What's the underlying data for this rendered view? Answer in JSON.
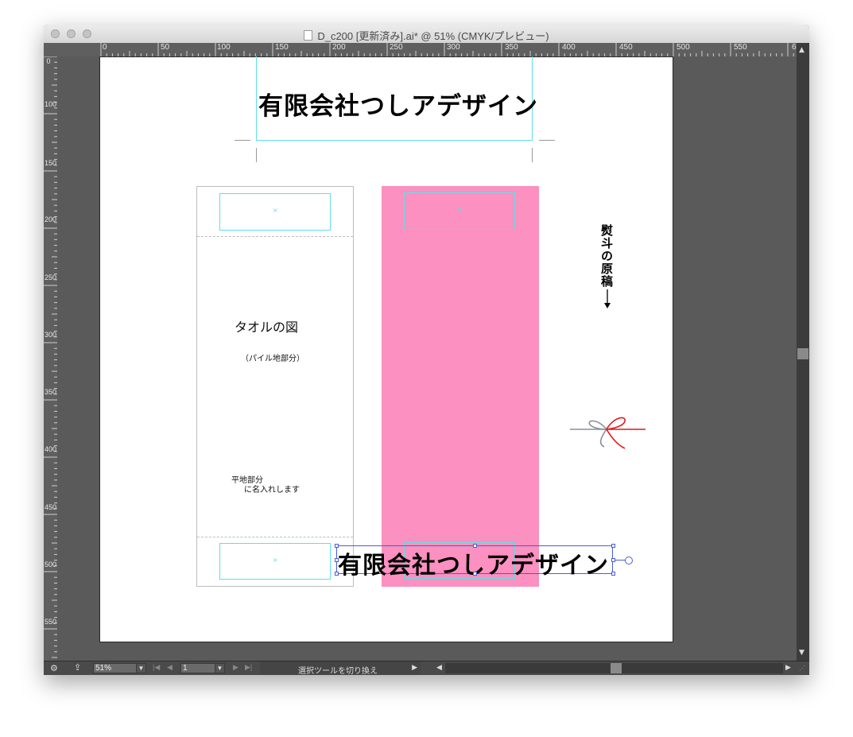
{
  "window": {
    "title": "D_c200 [更新済み].ai* @ 51% (CMYK/プレビュー)"
  },
  "ruler": {
    "top_labels": [
      "0",
      "50",
      "100",
      "150",
      "200",
      "250",
      "300",
      "350",
      "400",
      "450",
      "500",
      "550",
      "6"
    ],
    "left_labels": [
      "0",
      "100",
      "150",
      "200",
      "250",
      "300",
      "350",
      "400",
      "450",
      "500",
      "550"
    ]
  },
  "artwork": {
    "brand_top": "有限会社つしアデザイン",
    "brand_bottom": "有限会社つしアデザイン",
    "towel_label": "タオルの図",
    "pile_label": "（パイル地部分）",
    "flat_line1": "平地部分",
    "flat_line2": "に名入れします",
    "noshi_label": "熨斗の原稿",
    "guide_mark": "×",
    "pink_color": "#fc90c0"
  },
  "statusbar": {
    "zoom": "51%",
    "page": "1",
    "tool_label": "選択ツールを切り換え"
  }
}
